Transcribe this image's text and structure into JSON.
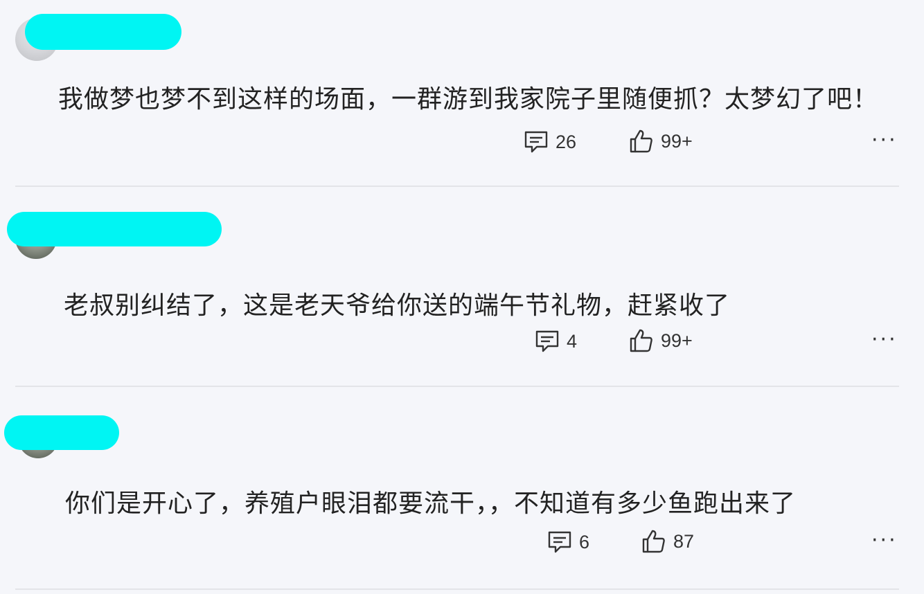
{
  "comments": [
    {
      "text": "我做梦也梦不到这样的场面，一群游到我家院子里随便抓？太梦幻了吧！",
      "reply_count": "26",
      "like_count": "99+",
      "more_label": "···",
      "avatar_style": "light"
    },
    {
      "text": "老叔别纠结了，这是老天爷给你送的端午节礼物，赶紧收了",
      "reply_count": "4",
      "like_count": "99+",
      "more_label": "···",
      "avatar_style": "dark"
    },
    {
      "text": "你们是开心了，养殖户眼泪都要流干，，不知道有多少鱼跑出来了",
      "reply_count": "6",
      "like_count": "87",
      "more_label": "···",
      "avatar_style": "dark"
    }
  ],
  "colors": {
    "background": "#f5f6fa",
    "name_redaction": "#00f5f3",
    "text": "#222222",
    "divider": "#e3e4e8"
  },
  "icons": {
    "reply": "comment-icon",
    "like": "thumbs-up-icon",
    "more": "more-options-icon"
  }
}
